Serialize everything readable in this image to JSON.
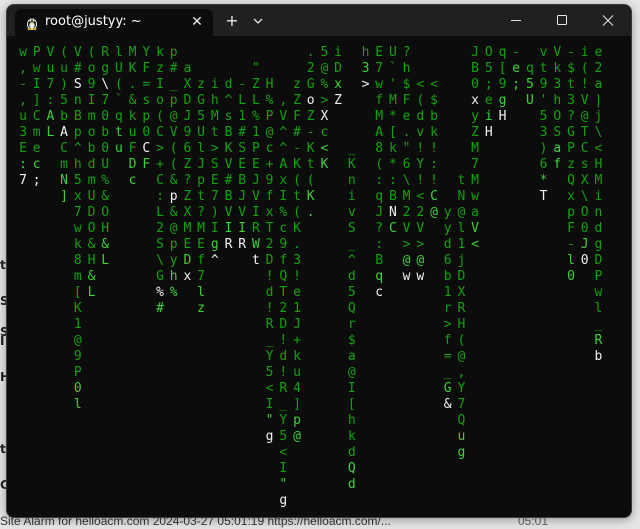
{
  "window": {
    "tab_title": "root@justyy: ~",
    "tab_close_icon": "close-icon",
    "new_tab_icon": "plus-icon",
    "dropdown_icon": "chevron-down-icon",
    "minimize_icon": "minimize-icon",
    "maximize_icon": "maximize-icon",
    "close_icon": "close-icon"
  },
  "colors": {
    "terminal_bg": "#0c0c0c",
    "titlebar_bg": "#202020",
    "rain_green": "#13a10e",
    "rain_bright": "#3ed13a",
    "rain_head": "#f2f2f2"
  },
  "background": {
    "left_fragments": [
      "t",
      "S",
      "S",
      "I",
      "H",
      "ti",
      "C"
    ],
    "footer_text": "Site Alarm for helloacm.com 2024-03-27 05:01:19 https://helloacm.com/...",
    "footer_time": "05:01"
  },
  "terminal": {
    "columns": [
      {
        "id": "c01",
        "start": 0,
        "chars": "w,-,u3E:7",
        "head": 8
      },
      {
        "id": "c02",
        "start": 0,
        "chars": "PwI]Cmec;",
        "head": 8
      },
      {
        "id": "c03",
        "start": 0,
        "chars": "Vu7:AL",
        "head": -1
      },
      {
        "id": "c04",
        "start": 0,
        "chars": "(u)5bACmN]",
        "head": 5
      },
      {
        "id": "c05",
        "start": 0,
        "chars": "V#SnBp^h5x7wk8m[K1@9P0l",
        "head": 2
      },
      {
        "id": "c06",
        "start": 0,
        "chars": "(o9ImobdmUDO&H&L",
        "head": -1
      },
      {
        "id": "c07",
        "start": 0,
        "chars": "Rg\\70b0U%&OH&L",
        "head": 2
      },
      {
        "id": "c08",
        "start": 0,
        "chars": "lU(`qtu",
        "head": -1
      },
      {
        "id": "c09",
        "start": 0,
        "chars": "MK.&kuFDc",
        "head": -1
      },
      {
        "id": "c10",
        "start": 0,
        "chars": "YF=sp0CF",
        "head": 6
      },
      {
        "id": "c11",
        "start": 0,
        "chars": "kzIo(C>+C:L2S\\G%#",
        "head": 15
      },
      {
        "id": "c12",
        "start": 0,
        "chars": "p#_p@V((&p&@pyh%",
        "head": 9
      },
      {
        "id": "c13",
        "start": 1,
        "chars": "aXDJ96Z?ZXMEDx",
        "head": 13
      },
      {
        "id": "c14",
        "start": 2,
        "chars": "zG5UlJpt?MEf7lz",
        "head": -1
      },
      {
        "id": "c15",
        "start": 2,
        "chars": "ihMt>SE7)Ig^",
        "head": 11
      },
      {
        "id": "c16",
        "start": 2,
        "chars": "d^sBKV#BVIR",
        "head": 10
      },
      {
        "id": "c17",
        "start": 2,
        "chars": "-L1#SEBJVIR",
        "head": 10
      },
      {
        "id": "c18",
        "start": 1,
        "chars": "\"ZL%1PEJVIRWt",
        "head": 12
      },
      {
        "id": "c19",
        "start": 2,
        "chars": "H%P@c+9fxT2D!d!R_Y5<I\"g",
        "head": 22
      },
      {
        "id": "c20",
        "start": 3,
        "chars": ",V^^AxI%c9fQT2D!d!R_Y5<I\"g",
        "head": 25
      },
      {
        "id": "c21",
        "start": 2,
        "chars": "zZF#-K(t(K.3!e1J+ku4]p@",
        "head": -1
      },
      {
        "id": "c22",
        "start": 0,
        "chars": ".2GoZ-Kt(K.",
        "head": 3
      },
      {
        "id": "c23",
        "start": 0,
        "chars": "5@%>Xc<K",
        "head": 4
      },
      {
        "id": "c24",
        "start": 0,
        "chars": "iDxZ",
        "head": 3
      },
      {
        "id": "c25",
        "start": 6,
        "chars": "_KnivS_^d5Qr$a@I[hkdQd",
        "head": -1
      },
      {
        "id": "c26",
        "start": 0,
        "chars": "h3>",
        "head": 2
      },
      {
        "id": "c27",
        "start": 0,
        "chars": "E7wfMA8(:qJ?:Bqc",
        "head": 15
      },
      {
        "id": "c28",
        "start": 0,
        "chars": "U`'M*[k*:BNC",
        "head": 10
      },
      {
        "id": "c29",
        "start": 0,
        "chars": "?h$Fe.\"6\\M2V>@w",
        "head": 14
      },
      {
        "id": "c30",
        "start": 2,
        "chars": "<(dv!Y!<2V>@w",
        "head": 12
      },
      {
        "id": "c31",
        "start": 2,
        "chars": "<$bk!:!C@",
        "head": -1
      },
      {
        "id": "c32",
        "start": 10,
        "chars": "yyd6b1r>f=_G&",
        "head": 12
      },
      {
        "id": "c33",
        "start": 8,
        "chars": "tN@l1jDXRH(@,Y7Qug",
        "head": -1
      },
      {
        "id": "c34",
        "start": 0,
        "chars": "JB0xyZM7MwaV<",
        "head": 3
      },
      {
        "id": "c35",
        "start": 0,
        "chars": "O5;eiH",
        "head": 5
      },
      {
        "id": "c36",
        "start": 0,
        "chars": "q[9gH",
        "head": 4
      },
      {
        "id": "c37",
        "start": 0,
        "chars": "-e;",
        "head": -1
      },
      {
        "id": "c38",
        "start": 1,
        "chars": "q5U",
        "head": -1
      },
      {
        "id": "c39",
        "start": 0,
        "chars": "vt9'53)6*T",
        "head": 9
      },
      {
        "id": "c40",
        "start": 0,
        "chars": "Vk3hOSaf",
        "head": 9
      },
      {
        "id": "c41",
        "start": 0,
        "chars": "-$t3?GPzQxpF-l0",
        "head": -1
      },
      {
        "id": "c42",
        "start": 0,
        "chars": "i(!V@TCsX\\O0J0",
        "head": 13
      },
      {
        "id": "c43",
        "start": 0,
        "chars": "e2a|j\\<HMindgDPwl_Rb",
        "head": 19
      }
    ]
  }
}
